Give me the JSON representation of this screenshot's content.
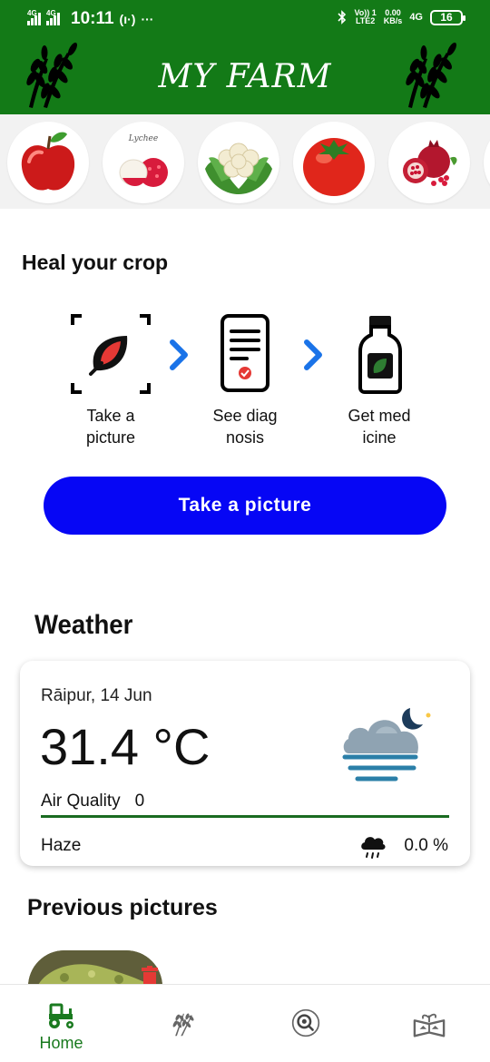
{
  "status_bar": {
    "signal1": "4G",
    "signal2": "4G",
    "time": "10:11",
    "hotspot": "(ı·)",
    "more": "···",
    "volte_top": "Vo)) 1",
    "volte_bottom": "LTE2",
    "speed_top": "0.00",
    "speed_bottom": "KB/s",
    "net": "4G",
    "battery": "16"
  },
  "header": {
    "title": "MY FARM"
  },
  "crops": [
    {
      "name": "apple-icon",
      "label": ""
    },
    {
      "name": "lychee-icon",
      "label": "Lychee"
    },
    {
      "name": "cauliflower-icon",
      "label": ""
    },
    {
      "name": "tomato-icon",
      "label": ""
    },
    {
      "name": "pomegranate-icon",
      "label": ""
    }
  ],
  "heal": {
    "title": "Heal your crop",
    "steps": [
      {
        "label_line1": "Take a",
        "label_line2": "picture"
      },
      {
        "label_line1": "See diag",
        "label_line2": "nosis"
      },
      {
        "label_line1": "Get med",
        "label_line2": "icine"
      }
    ],
    "cta": "Take a picture"
  },
  "weather": {
    "title": "Weather",
    "location": "Rāipur, 14  Jun",
    "temperature": "31.4 °C",
    "air_quality_label": "Air Quality",
    "air_quality_value": "0",
    "condition": "Haze",
    "rain": "0.0 %"
  },
  "previous": {
    "title": "Previous pictures"
  },
  "nav": {
    "home": "Home"
  },
  "colors": {
    "brand_green": "#137a17",
    "cta_blue": "#0606f5",
    "arrow_blue": "#1a73e8",
    "aq_line": "#1a6b21"
  }
}
